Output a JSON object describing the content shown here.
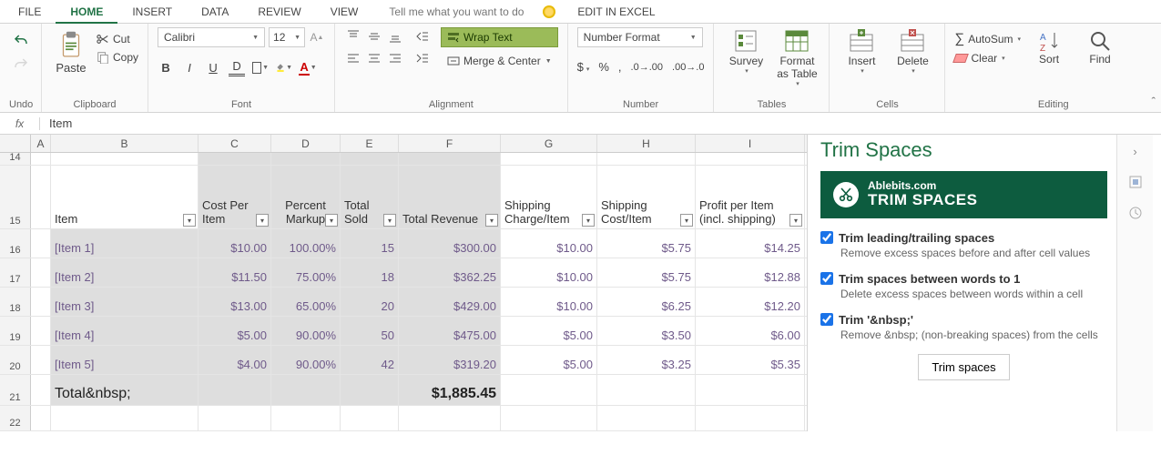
{
  "menu": {
    "file": "FILE",
    "home": "HOME",
    "insert": "INSERT",
    "data": "DATA",
    "review": "REVIEW",
    "view": "VIEW",
    "tellme": "Tell me what you want to do",
    "edit_excel": "EDIT IN EXCEL"
  },
  "ribbon": {
    "undo": "Undo",
    "clipboard": "Clipboard",
    "paste": "Paste",
    "cut": "Cut",
    "copy": "Copy",
    "font_group": "Font",
    "font_name": "Calibri",
    "font_size": "12",
    "alignment": "Alignment",
    "wrap": "Wrap Text",
    "merge": "Merge & Center",
    "number_group": "Number",
    "number_format": "Number Format",
    "tables": "Tables",
    "survey": "Survey",
    "format_table": "Format as Table",
    "cells": "Cells",
    "insert": "Insert",
    "delete": "Delete",
    "editing": "Editing",
    "autosum": "AutoSum",
    "clear": "Clear",
    "sort": "Sort",
    "find": "Find"
  },
  "formula": {
    "fx": "fx",
    "value": "Item"
  },
  "cols": {
    "A": "A",
    "B": "B",
    "C": "C",
    "D": "D",
    "E": "E",
    "F": "F",
    "G": "G",
    "H": "H",
    "I": "I"
  },
  "rownums": {
    "r14": "14",
    "r15": "15",
    "r16": "16",
    "r17": "17",
    "r18": "18",
    "r19": "19",
    "r20": "20",
    "r21": "21",
    "r22": "22"
  },
  "headers": {
    "item": "Item",
    "cost": "Cost  Per Item",
    "markup": "Percent Markup",
    "sold": "Total Sold",
    "revenue": "Total Revenue",
    "ship_charge": "Shipping Charge/Item",
    "ship_cost": "Shipping Cost/Item",
    "profit": "Profit per Item (incl. shipping)"
  },
  "rows": [
    {
      "item": "[Item 1]",
      "cost": "$10.00",
      "markup": "100.00%",
      "sold": "15",
      "rev": "$300.00",
      "scharge": "$10.00",
      "scost": "$5.75",
      "profit": "$14.25"
    },
    {
      "item": "[Item 2]",
      "cost": "$11.50",
      "markup": "75.00%",
      "sold": "18",
      "rev": "$362.25",
      "scharge": "$10.00",
      "scost": "$5.75",
      "profit": "$12.88"
    },
    {
      "item": "[Item 3]",
      "cost": "$13.00",
      "markup": "65.00%",
      "sold": "20",
      "rev": "$429.00",
      "scharge": "$10.00",
      "scost": "$6.25",
      "profit": "$12.20"
    },
    {
      "item": "[Item 4]",
      "cost": "$5.00",
      "markup": "90.00%",
      "sold": "50",
      "rev": "$475.00",
      "scharge": "$5.00",
      "scost": "$3.50",
      "profit": "$6.00"
    },
    {
      "item": "[Item 5]",
      "cost": "$4.00",
      "markup": "90.00%",
      "sold": "42",
      "rev": "$319.20",
      "scharge": "$5.00",
      "scost": "$3.25",
      "profit": "$5.35"
    }
  ],
  "total": {
    "label": "Total&nbsp;",
    "value": "$1,885.45"
  },
  "pane": {
    "title": "Trim Spaces",
    "brand_top": "Ablebits.com",
    "brand_bot": "TRIM SPACES",
    "opt1_t": "Trim leading/trailing spaces",
    "opt1_d": "Remove excess spaces before and after cell values",
    "opt2_t": "Trim spaces between words to 1",
    "opt2_d": "Delete excess spaces between words within a cell",
    "opt3_t": "Trim '&nbsp;'",
    "opt3_d": "Remove &nbsp; (non-breaking spaces) from the cells",
    "button": "Trim spaces"
  }
}
